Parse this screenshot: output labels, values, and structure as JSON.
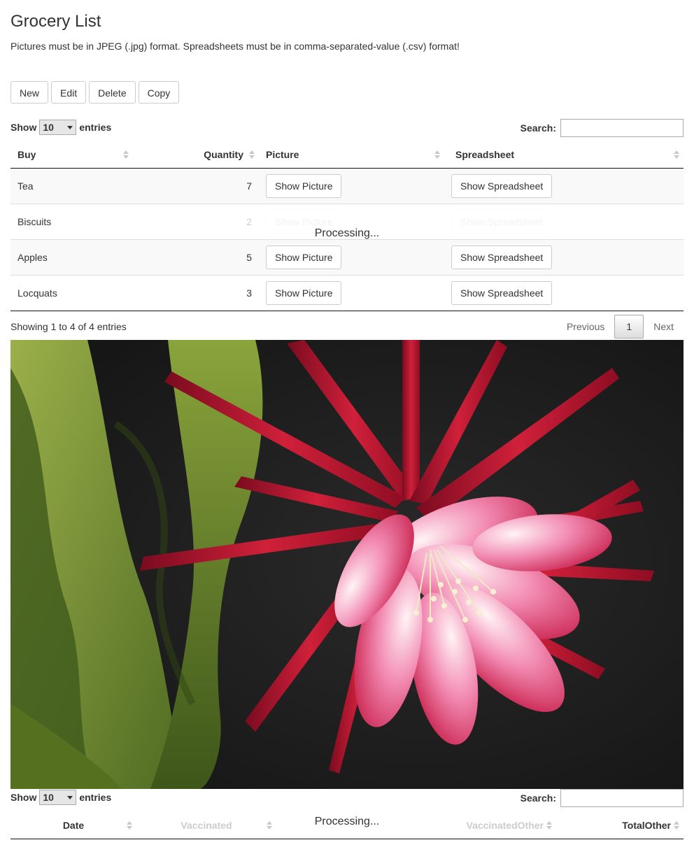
{
  "page": {
    "title": "Grocery List",
    "subtitle": "Pictures must be in JPEG (.jpg) format. Spreadsheets must be in comma-separated-value (.csv) format!"
  },
  "toolbar": {
    "new_label": "New",
    "edit_label": "Edit",
    "delete_label": "Delete",
    "copy_label": "Copy"
  },
  "table1": {
    "length": {
      "show": "Show",
      "value": "10",
      "entries": "entries"
    },
    "search_label": "Search:",
    "search_value": "",
    "columns": {
      "buy": "Buy",
      "quantity": "Quantity",
      "picture": "Picture",
      "spreadsheet": "Spreadsheet"
    },
    "rows": [
      {
        "buy": "Tea",
        "quantity": "7",
        "picture_button": "Show Picture",
        "spreadsheet_button": "Show Spreadsheet"
      },
      {
        "buy": "Biscuits",
        "quantity": "2",
        "picture_button": "Show Picture",
        "spreadsheet_button": "Show Spreadsheet"
      },
      {
        "buy": "Apples",
        "quantity": "5",
        "picture_button": "Show Picture",
        "spreadsheet_button": "Show Spreadsheet"
      },
      {
        "buy": "Locquats",
        "quantity": "3",
        "picture_button": "Show Picture",
        "spreadsheet_button": "Show Spreadsheet"
      }
    ],
    "processing": "Processing...",
    "info": "Showing 1 to 4 of 4 entries",
    "pager": {
      "previous": "Previous",
      "current": "1",
      "next": "Next"
    }
  },
  "photo": {
    "subject": "pink epiphyllum cactus flower"
  },
  "table2": {
    "length": {
      "show": "Show",
      "value": "10",
      "entries": "entries"
    },
    "search_label": "Search:",
    "columns": {
      "date": "Date",
      "vaccinated": "Vaccinated",
      "vaccinated_other": "VaccinatedOther",
      "total_other": "TotalOther"
    },
    "processing": "Processing..."
  },
  "colors": {
    "header_rule": "#111111",
    "row_stripe": "#f9f9f9",
    "photo_bg": "#1c1c1c",
    "petal_red": "#b0122a",
    "petal_pink": "#e84d8a"
  }
}
